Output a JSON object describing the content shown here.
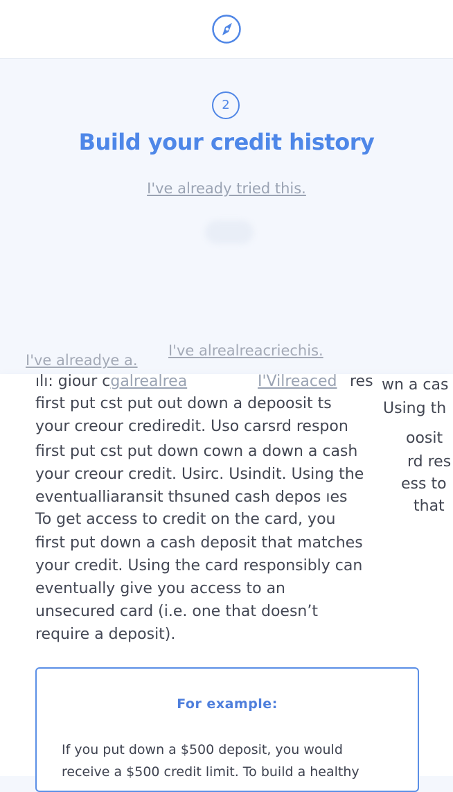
{
  "header": {
    "logo_icon": "compass-icon"
  },
  "step": {
    "number": "2",
    "title": "Build your credit history",
    "tried_link": "I've already tried this."
  },
  "ghost_links": [
    "I've alreadye a.",
    "I've alrealreacriechis.",
    "galrealrea",
    "I'Vilreaced"
  ],
  "garbled_lines": [
    "ılı: giour c",
    "first put cst put out down a depoosit ts",
    "your creour crediredit. Uso carsrd respon",
    "first put cst put down cown a down a cash",
    "your creour credit. Usirc. Usindit. Using the",
    "eventualliaransit thsuned cash depos ıes",
    "res",
    "wn a cas",
    "Using th",
    "oosit",
    "rd res",
    "ess to",
    "that"
  ],
  "description": [
    "To get access to credit on the card, you",
    "first put down a cash deposit that matches",
    "your credit. Using the card responsibly can",
    "eventually give you access to an",
    "unsecured card (i.e. one that doesn’t",
    "require a deposit)."
  ],
  "example": {
    "heading": "For example:",
    "lines": [
      "If you put down a $500 deposit, you would",
      "receive a $500 credit limit. To build a healthy"
    ]
  },
  "colors": {
    "accent": "#4e87e8",
    "muted_link": "#9aa3b3",
    "body_text": "#444855"
  }
}
